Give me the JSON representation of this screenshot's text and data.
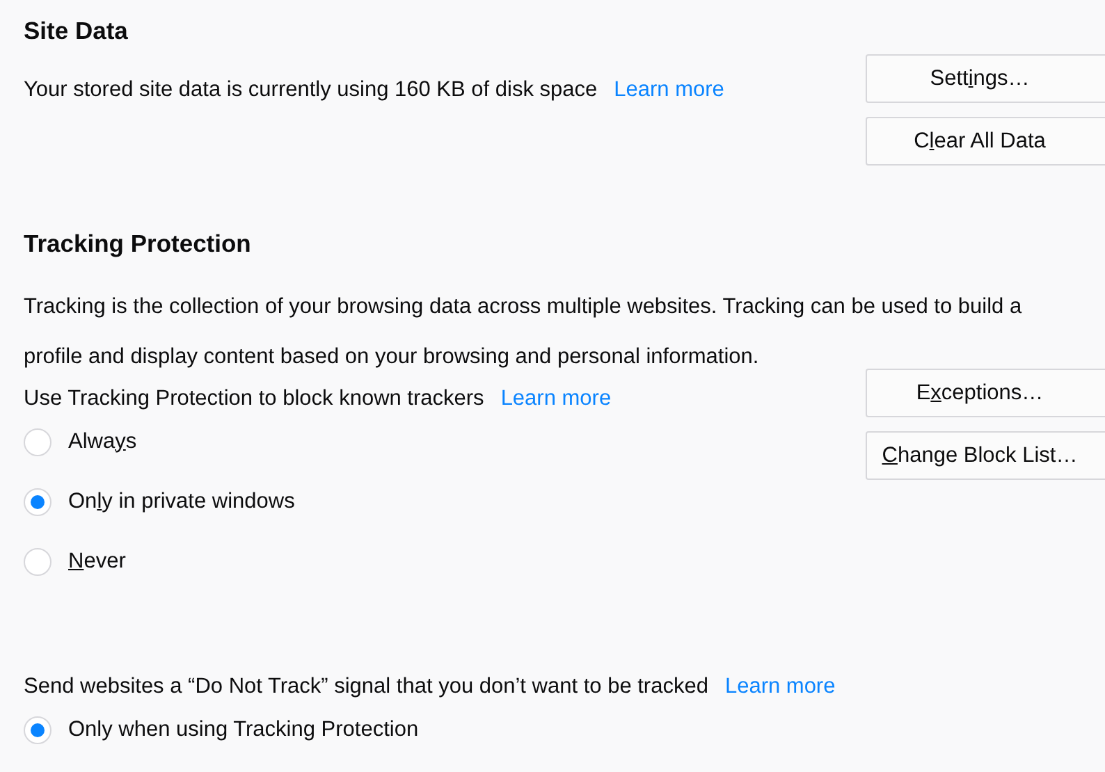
{
  "site_data": {
    "heading": "Site Data",
    "usage_text": "Your stored site data is currently using 160 KB of disk space",
    "learn_more": "Learn more",
    "buttons": [
      {
        "before": "Sett",
        "key": "i",
        "after": "ngs…"
      },
      {
        "before": "C",
        "key": "l",
        "after": "ear All Data"
      }
    ]
  },
  "tracking": {
    "heading": "Tracking Protection",
    "description": "Tracking is the collection of your browsing data across multiple websites. Tracking can be used to build a profile and display content based on your browsing and personal information.",
    "use_text": "Use Tracking Protection to block known trackers",
    "learn_more": "Learn more",
    "options": [
      {
        "before": "Alwa",
        "key": "y",
        "after": "s",
        "selected": false
      },
      {
        "before": "On",
        "key": "l",
        "after": "y in private windows",
        "selected": true
      },
      {
        "key": "N",
        "after": "ever",
        "selected": false
      }
    ],
    "buttons": [
      {
        "before": "E",
        "key": "x",
        "after": "ceptions…"
      },
      {
        "key": "C",
        "after": "hange Block List…"
      }
    ]
  },
  "do_not_track": {
    "text": "Send websites a “Do Not Track” signal that you don’t want to be tracked",
    "learn_more": "Learn more",
    "options": [
      {
        "after": "Only when using Tracking Protection",
        "selected": true
      }
    ]
  }
}
